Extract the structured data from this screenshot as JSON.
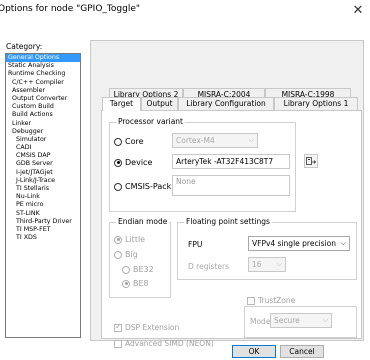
{
  "window": {
    "title": "Options for node \"GPIO_Toggle\""
  },
  "category": {
    "label": "Category:",
    "items": [
      {
        "label": "General Options",
        "level": 0,
        "selected": true
      },
      {
        "label": "Static Analysis",
        "level": 0
      },
      {
        "label": "Runtime Checking",
        "level": 0
      },
      {
        "label": "C/C++ Compiler",
        "level": 1
      },
      {
        "label": "Assembler",
        "level": 1
      },
      {
        "label": "Output Converter",
        "level": 1
      },
      {
        "label": "Custom Build",
        "level": 1
      },
      {
        "label": "Build Actions",
        "level": 1
      },
      {
        "label": "Linker",
        "level": 1
      },
      {
        "label": "Debugger",
        "level": 1
      },
      {
        "label": "Simulator",
        "level": 2
      },
      {
        "label": "CADI",
        "level": 2
      },
      {
        "label": "CMSIS DAP",
        "level": 2
      },
      {
        "label": "GDB Server",
        "level": 2
      },
      {
        "label": "I-jet/JTAGjet",
        "level": 2
      },
      {
        "label": "J-Link/J-Trace",
        "level": 2
      },
      {
        "label": "TI Stellaris",
        "level": 2
      },
      {
        "label": "Nu-Link",
        "level": 2
      },
      {
        "label": "PE micro",
        "level": 2
      },
      {
        "label": "ST-LINK",
        "level": 2
      },
      {
        "label": "Third-Party Driver",
        "level": 2
      },
      {
        "label": "TI MSP-FET",
        "level": 2
      },
      {
        "label": "TI XDS",
        "level": 2
      }
    ]
  },
  "tabs_back": [
    "Library Options 2",
    "MISRA-C:2004",
    "MISRA-C:1998"
  ],
  "tabs_front": [
    "Target",
    "Output",
    "Library Configuration",
    "Library Options 1"
  ],
  "processor": {
    "group_title": "Processor variant",
    "core_label": "Core",
    "core_value": "Cortex-M4",
    "device_label": "Device",
    "device_value": "ArteryTek -AT32F413C8T7",
    "cmsis_label": "CMSIS-Pack",
    "cmsis_value": "None"
  },
  "endian": {
    "group_title": "Endian mode",
    "little": "Little",
    "big": "Big",
    "be32": "BE32",
    "be8": "BE8"
  },
  "float": {
    "group_title": "Floating point settings",
    "fpu_label": "FPU",
    "fpu_value": "VFPv4 single precision",
    "dreg_label": "D registers",
    "dreg_value": "16"
  },
  "extensions": {
    "dsp": "DSP Extension",
    "simd": "Advanced SIMD (NEON)"
  },
  "trustzone": {
    "label": "TrustZone",
    "mode_label": "Mode",
    "mode_value": "Secure"
  },
  "buttons": {
    "ok": "OK",
    "cancel": "Cancel"
  }
}
